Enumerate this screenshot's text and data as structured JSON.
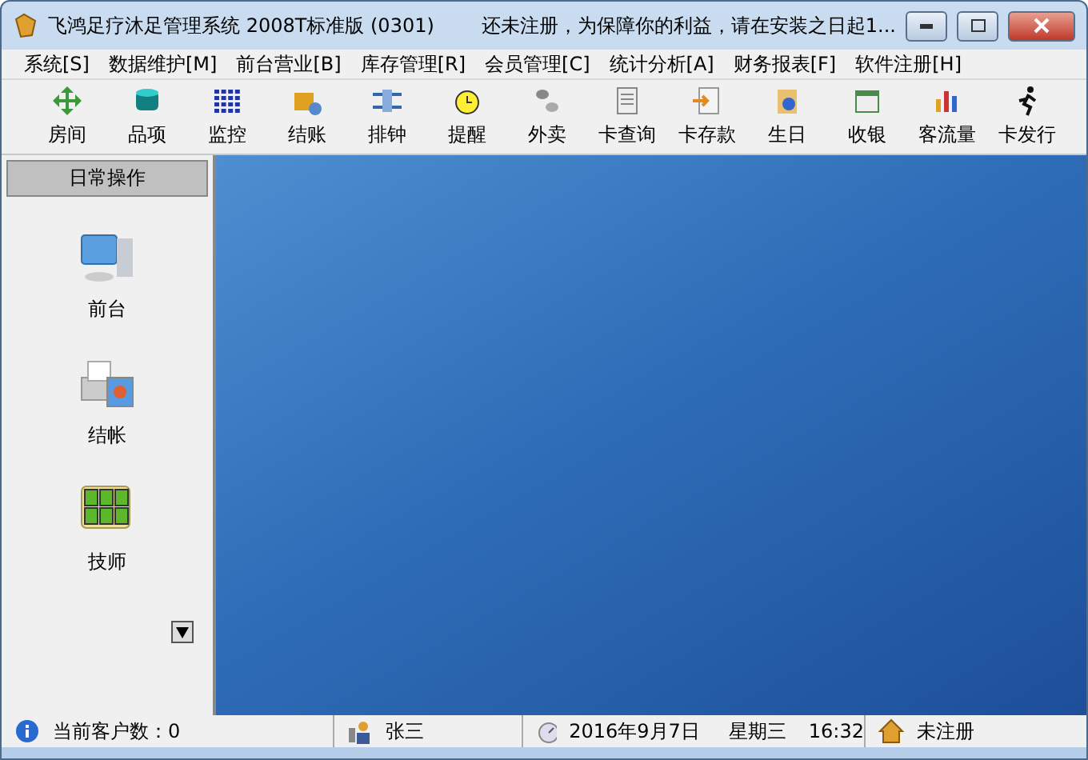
{
  "window": {
    "title": "飞鸿足疗沐足管理系统  2008T标准版 (0301)",
    "notice": "还未注册，为保障你的利益，请在安装之日起1..."
  },
  "menu": [
    "系统[S]",
    "数据维护[M]",
    "前台营业[B]",
    "库存管理[R]",
    "会员管理[C]",
    "统计分析[A]",
    "财务报表[F]",
    "软件注册[H]"
  ],
  "toolbar": [
    {
      "label": "房间",
      "kind": "move"
    },
    {
      "label": "品项",
      "kind": "drum"
    },
    {
      "label": "监控",
      "kind": "grid"
    },
    {
      "label": "结账",
      "kind": "box"
    },
    {
      "label": "排钟",
      "kind": "arrows"
    },
    {
      "label": "提醒",
      "kind": "clock"
    },
    {
      "label": "外卖",
      "kind": "coins"
    },
    {
      "label": "卡查询",
      "kind": "doc"
    },
    {
      "label": "卡存款",
      "kind": "deposit"
    },
    {
      "label": "生日",
      "kind": "gear"
    },
    {
      "label": "收银",
      "kind": "calendar"
    },
    {
      "label": "客流量",
      "kind": "chart"
    },
    {
      "label": "卡发行",
      "kind": "runner"
    }
  ],
  "sidebar": {
    "title": "日常操作",
    "items": [
      {
        "label": "前台",
        "kind": "computer"
      },
      {
        "label": "结帐",
        "kind": "printer"
      },
      {
        "label": "技师",
        "kind": "keypad"
      }
    ]
  },
  "status_bar": {
    "customers": "当前客户数：0",
    "user": "张三",
    "date": "2016年9月7日",
    "weekday": "星期三",
    "time": "16:32",
    "registration": "未注册"
  }
}
